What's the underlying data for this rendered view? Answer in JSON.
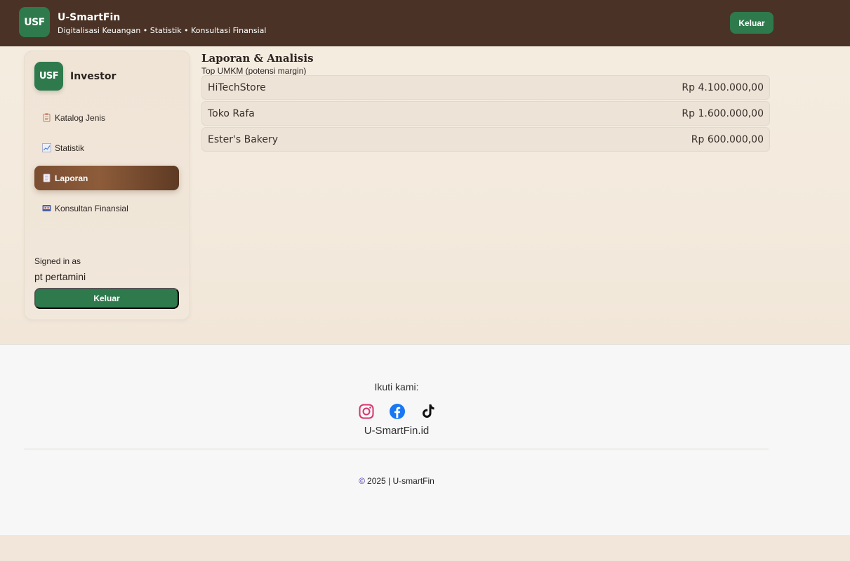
{
  "header": {
    "logo": "USF",
    "title": "U-SmartFin",
    "subtitle": "Digitalisasi Keuangan • Statistik • Konsultasi Finansial",
    "logout_label": "Keluar"
  },
  "sidebar": {
    "logo": "USF",
    "role": "Investor",
    "items": [
      {
        "label": "Katalog Jenis",
        "icon": "clipboard-icon",
        "active": false
      },
      {
        "label": "Statistik",
        "icon": "chart-icon",
        "active": false
      },
      {
        "label": "Laporan",
        "icon": "document-icon",
        "active": true
      },
      {
        "label": "Konsultan Finansial",
        "icon": "consultant-icon",
        "active": false
      }
    ],
    "signed_in_label": "Signed in as",
    "signed_in_user": "pt pertamini",
    "logout_label": "Keluar"
  },
  "content": {
    "title": "Laporan & Analisis",
    "subtitle": "Top UMKM (potensi margin)",
    "rows": [
      {
        "name": "HiTechStore",
        "value": "Rp 4.100.000,00"
      },
      {
        "name": "Toko Rafa",
        "value": "Rp 1.600.000,00"
      },
      {
        "name": "Ester's Bakery",
        "value": "Rp 600.000,00"
      }
    ]
  },
  "footer": {
    "follow_label": "Ikuti kami:",
    "socials": [
      "instagram-icon",
      "facebook-icon",
      "tiktok-icon"
    ],
    "site_name": "U-SmartFin.id",
    "copyright": "2025 | U-smartFin"
  },
  "colors": {
    "header_bg": "#4a3326",
    "accent_green": "#2f7a4d",
    "active_nav": "#7a4d31"
  }
}
